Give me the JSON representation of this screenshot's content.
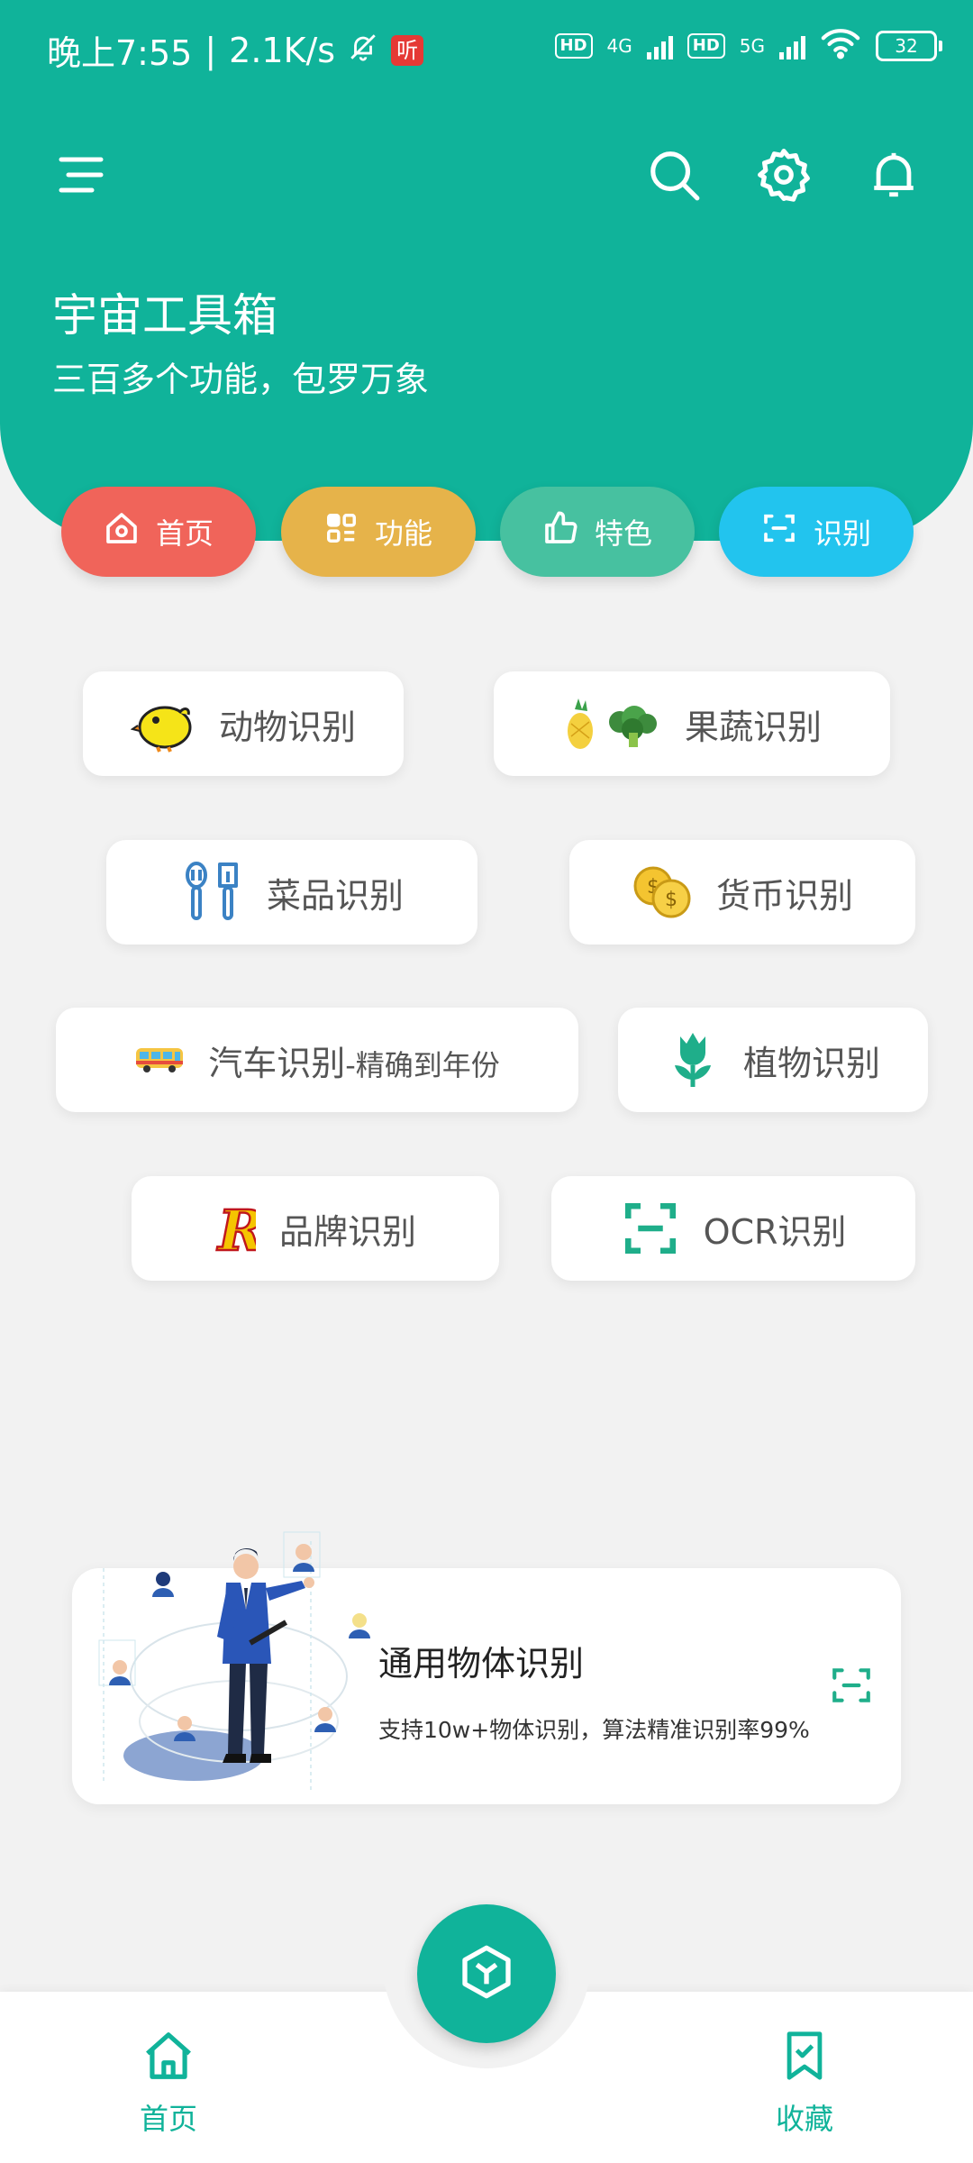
{
  "status_bar": {
    "time": "晚上7:55",
    "speed": "2.1K/s",
    "ting": "听",
    "hd1": "HD",
    "net1": "4G",
    "hd2": "HD",
    "net2": "5G",
    "battery": "32"
  },
  "header": {
    "title": "宇宙工具箱",
    "subtitle": "三百多个功能，包罗万象",
    "menu_icon": "menu-icon",
    "search_icon": "search-icon",
    "settings_icon": "gear-icon",
    "bell_icon": "bell-icon",
    "color": "#10b39a"
  },
  "tabs": [
    {
      "label": "首页",
      "color": "#f0645a",
      "icon": "home-icon"
    },
    {
      "label": "功能",
      "color": "#e6b34a",
      "icon": "grid-icon"
    },
    {
      "label": "特色",
      "color": "#47c1a0",
      "icon": "thumbs-up-icon"
    },
    {
      "label": "识别",
      "color": "#22c4ee",
      "icon": "scan-icon"
    }
  ],
  "recognition_items": [
    {
      "label": "动物识别",
      "icon": "chick-icon"
    },
    {
      "label": "果蔬识别",
      "icon": "pineapple-broccoli-icon"
    },
    {
      "label": "菜品识别",
      "icon": "utensils-icon"
    },
    {
      "label": "货币识别",
      "icon": "coins-icon"
    },
    {
      "label": "汽车识别",
      "suffix": "-精确到年份",
      "icon": "bus-icon"
    },
    {
      "label": "植物识别",
      "icon": "tulip-icon"
    },
    {
      "label": "品牌识别",
      "icon": "brand-r-icon"
    },
    {
      "label": "OCR识别",
      "icon": "ocr-scan-icon"
    }
  ],
  "banner": {
    "title": "通用物体识别",
    "description": "支持10w+物体识别，算法精准识别率99%",
    "icon": "scan-icon"
  },
  "bottom_nav": {
    "home_label": "首页",
    "favorites_label": "收藏",
    "fab_icon": "cube-icon"
  }
}
